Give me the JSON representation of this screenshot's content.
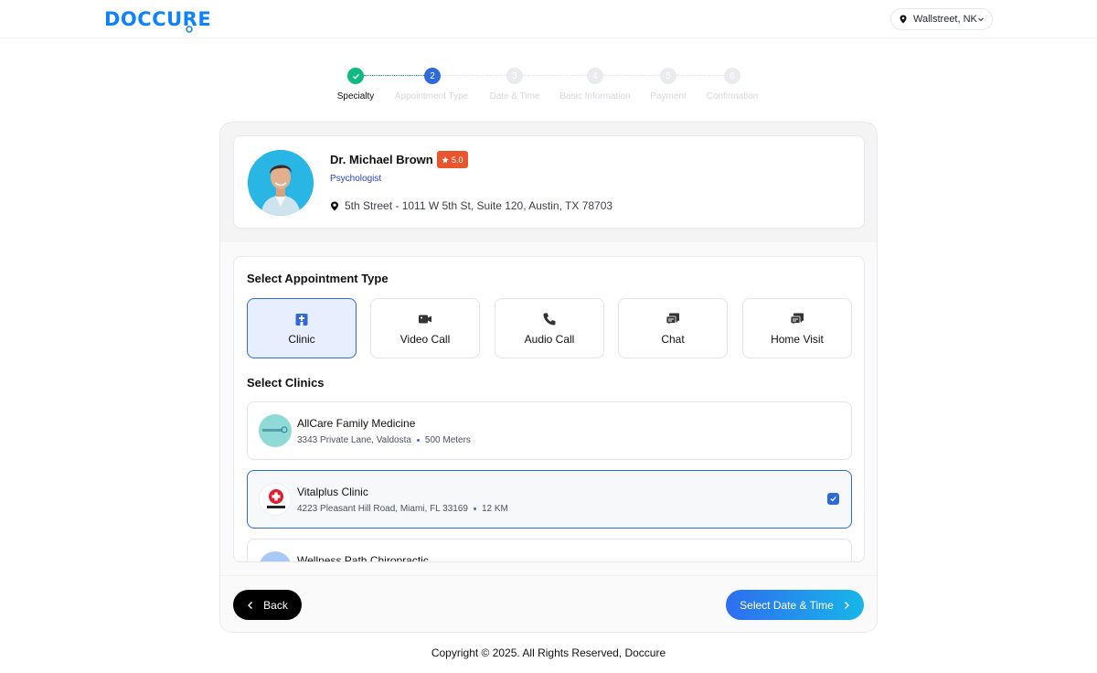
{
  "header": {
    "logo_text": "DOCCURE",
    "location": "Wallstreet, NK"
  },
  "stepper": {
    "steps": [
      {
        "number": "",
        "label": "Specialty",
        "state": "done"
      },
      {
        "number": "2",
        "label": "Appointment Type",
        "state": "current"
      },
      {
        "number": "3",
        "label": "Date & Time",
        "state": "upcoming"
      },
      {
        "number": "4",
        "label": "Basic Information",
        "state": "upcoming"
      },
      {
        "number": "5",
        "label": "Payment",
        "state": "upcoming"
      },
      {
        "number": "6",
        "label": "Confirmation",
        "state": "upcoming"
      }
    ]
  },
  "doctor": {
    "name": "Dr. Michael Brown",
    "rating": "5.0",
    "specialty": "Psychologist",
    "address": "5th Street - 1011 W 5th St, Suite 120, Austin, TX 78703"
  },
  "appointment": {
    "title": "Select Appointment Type",
    "types": [
      {
        "label": "Clinic",
        "icon": "hospital-icon",
        "selected": true
      },
      {
        "label": "Video Call",
        "icon": "video-icon",
        "selected": false
      },
      {
        "label": "Audio Call",
        "icon": "phone-icon",
        "selected": false
      },
      {
        "label": "Chat",
        "icon": "chat-icon",
        "selected": false
      },
      {
        "label": "Home Visit",
        "icon": "chat-icon",
        "selected": false
      }
    ]
  },
  "clinics": {
    "title": "Select Clinics",
    "items": [
      {
        "name": "AllCare Family Medicine",
        "address": "3343 Private Lane, Valdosta",
        "distance": "500 Meters",
        "selected": false
      },
      {
        "name": "Vitalplus Clinic",
        "address": "4223 Pleasant Hill Road, Miami, FL 33169",
        "distance": "12 KM",
        "selected": true
      },
      {
        "name": "Wellness Path Chiropractic",
        "address": "",
        "distance": "",
        "selected": false
      }
    ]
  },
  "actions": {
    "back_label": "Back",
    "next_label": "Select Date & Time"
  },
  "footer": {
    "copyright": "Copyright © 2025. All Rights Reserved, Doccure"
  },
  "colors": {
    "brand": "#0e82fd",
    "accent": "#2f6bd8",
    "done": "#10b981",
    "rating": "#e8552f"
  }
}
